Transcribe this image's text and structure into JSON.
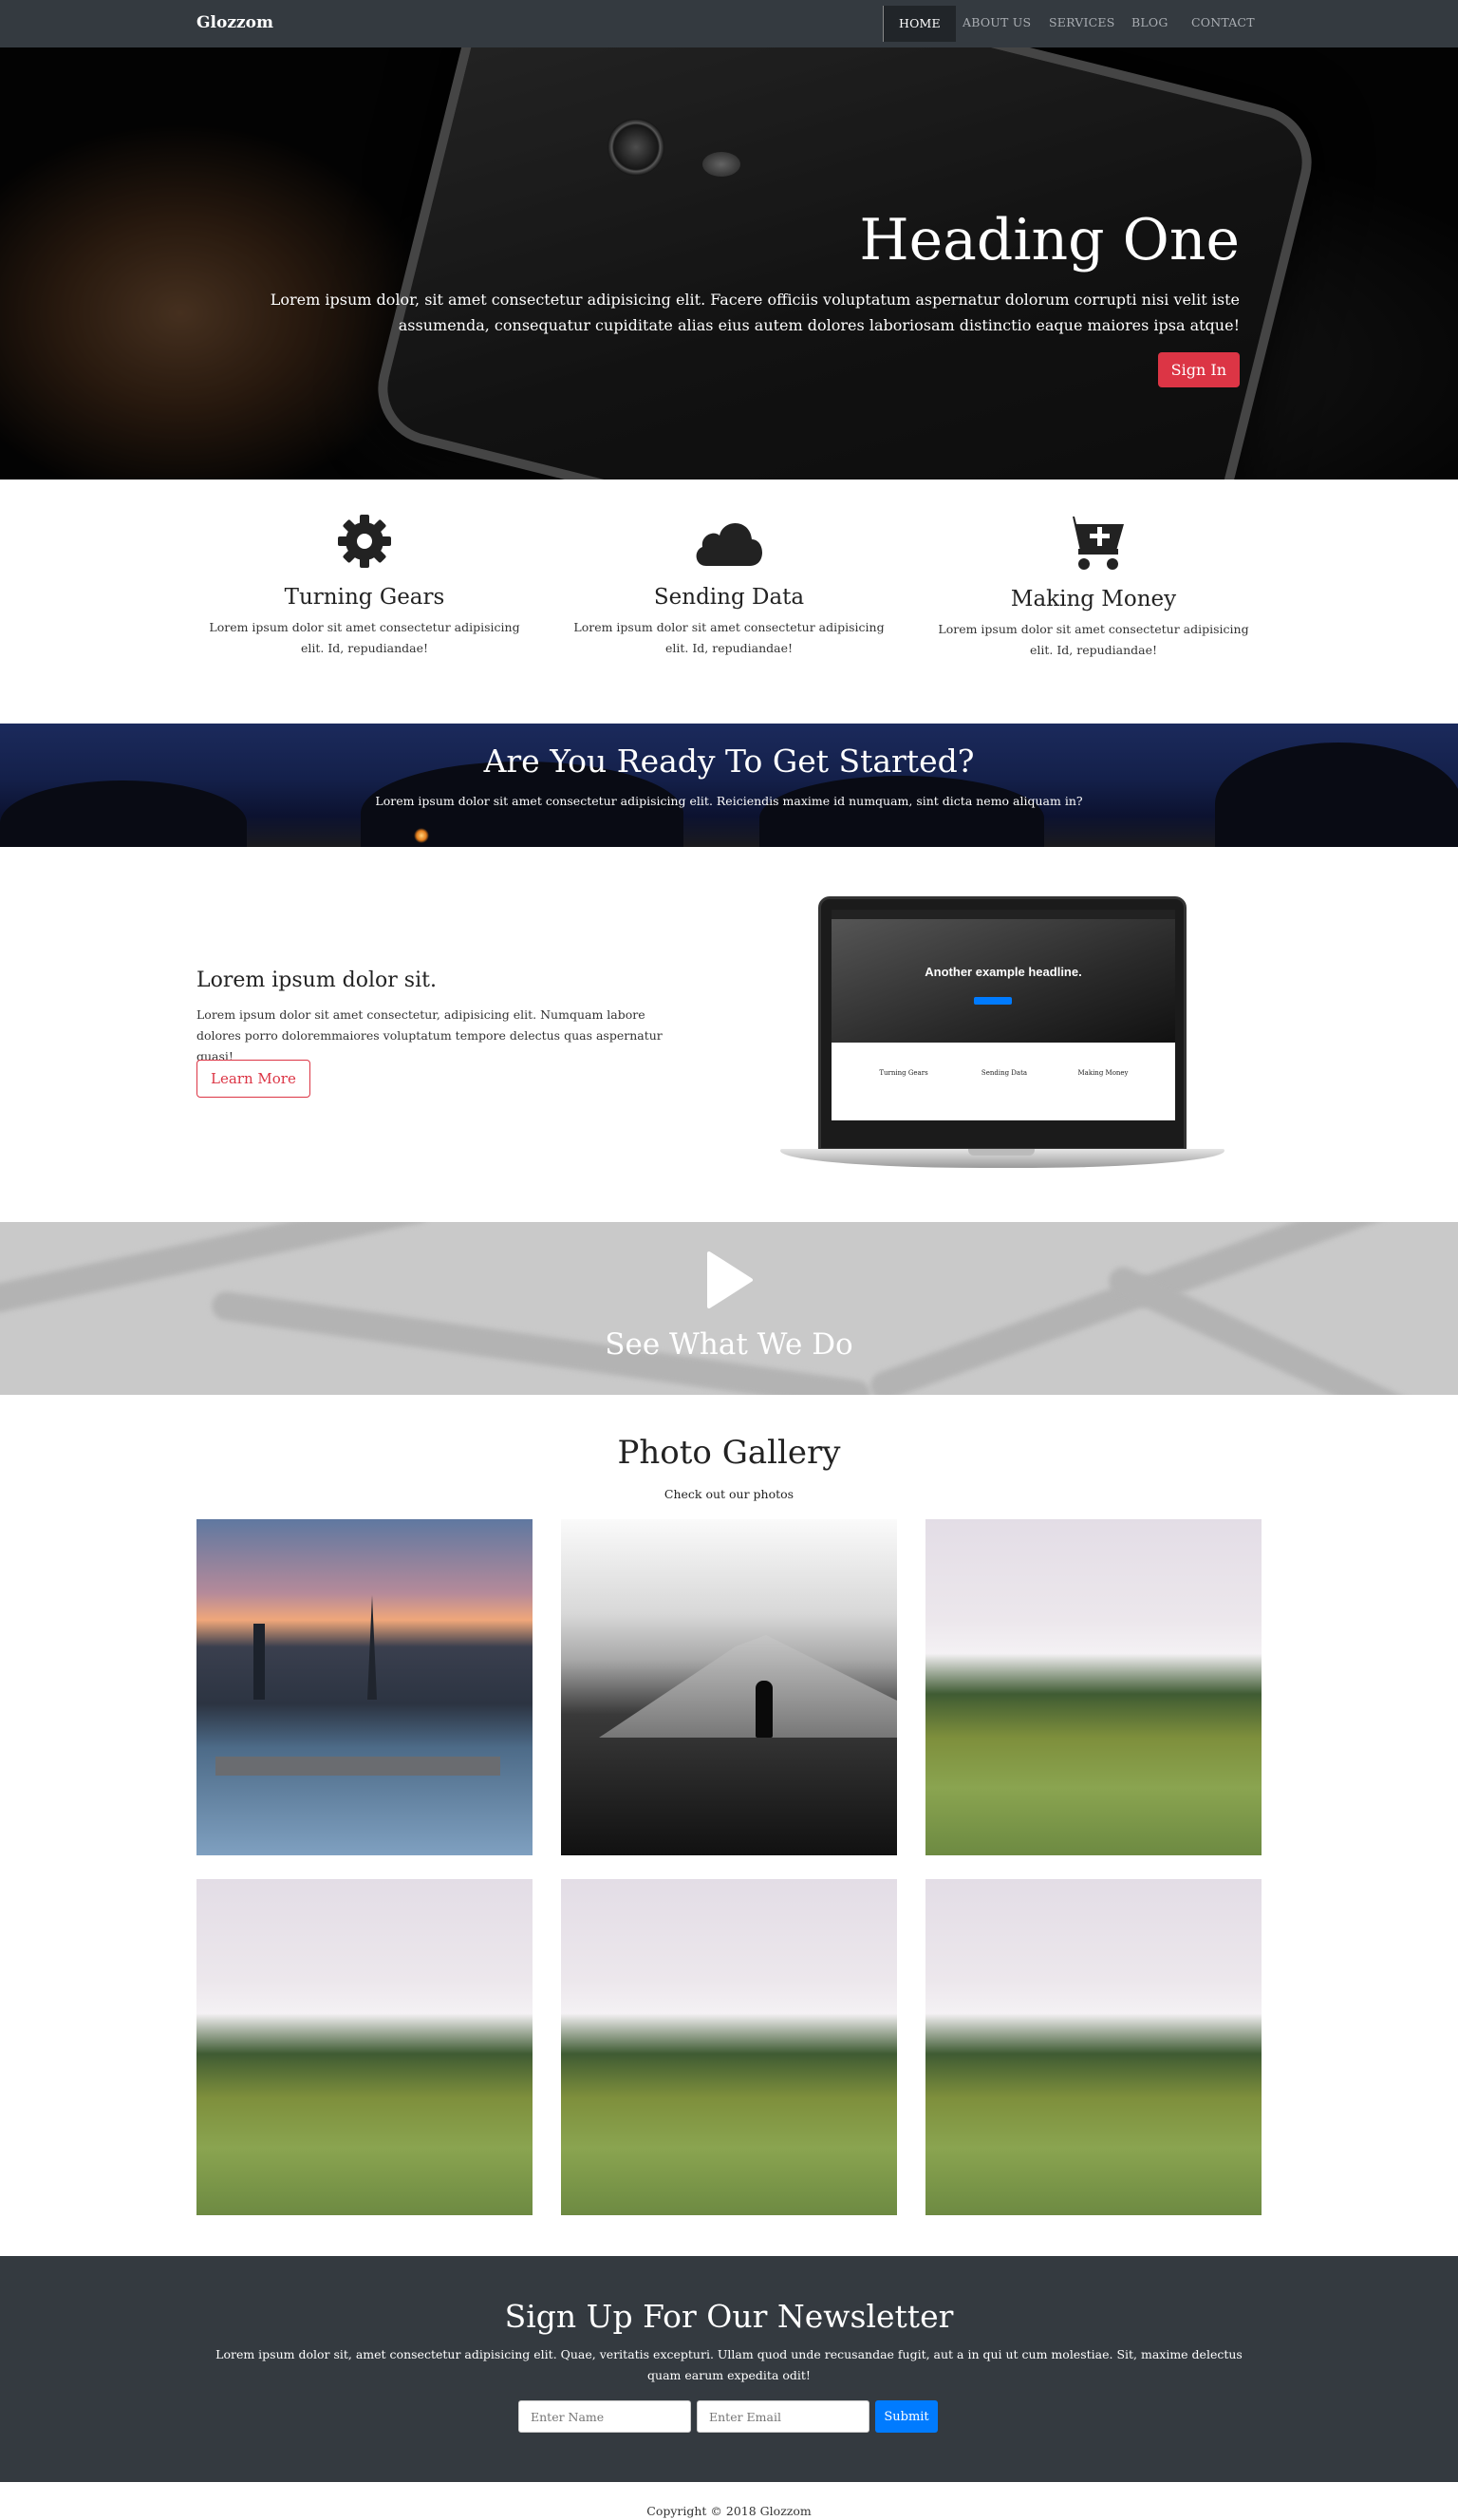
{
  "nav": {
    "brand": "Glozzom",
    "items": [
      "HOME",
      "ABOUT US",
      "SERVICES",
      "BLOG",
      "CONTACT"
    ],
    "active": "HOME"
  },
  "hero": {
    "title": "Heading One",
    "text": "Lorem ipsum dolor, sit amet consectetur adipisicing elit. Facere officiis voluptatum aspernatur dolorum corrupti nisi velit iste assumenda, consequatur cupiditate alias eius autem dolores laboriosam distinctio eaque maiores ipsa atque!",
    "button": "Sign In"
  },
  "features": [
    {
      "icon": "gear-icon",
      "title": "Turning Gears",
      "text": "Lorem ipsum dolor sit amet consectetur adipisicing elit. Id, repudiandae!"
    },
    {
      "icon": "cloud-icon",
      "title": "Sending Data",
      "text": "Lorem ipsum dolor sit amet consectetur adipisicing elit. Id, repudiandae!"
    },
    {
      "icon": "cart-plus-icon",
      "title": "Making Money",
      "text": "Lorem ipsum dolor sit amet consectetur adipisicing elit. Id, repudiandae!"
    }
  ],
  "ready": {
    "title": "Are You Ready To Get Started?",
    "text": "Lorem ipsum dolor sit amet consectetur adipisicing elit. Reiciendis maxime id numquam, sint dicta nemo aliquam in?"
  },
  "info": {
    "title": "Lorem ipsum dolor sit.",
    "text": "Lorem ipsum dolor sit amet consectetur, adipisicing elit. Numquam labore dolores porro doloremmaiores voluptatum tempore delectus quas aspernatur quasi!",
    "button": "Learn More"
  },
  "laptop": {
    "headline": "Another example headline.",
    "features": [
      "Turning Gears",
      "Sending Data",
      "Making Money"
    ]
  },
  "video": {
    "text": "See What We Do"
  },
  "gallery": {
    "title": "Photo Gallery",
    "subtitle": "Check out our photos"
  },
  "newsletter": {
    "title": "Sign Up For Our Newsletter",
    "text": "Lorem ipsum dolor sit, amet consectetur adipisicing elit. Quae, veritatis excepturi. Ullam quod unde recusandae fugit, aut a in qui ut cum molestiae. Sit, maxime delectus quam earum expedita odit!",
    "name_placeholder": "Enter Name",
    "email_placeholder": "Enter Email",
    "button": "Submit"
  },
  "footer": {
    "copyright": "Copyright © 2018 Glozzom"
  },
  "colors": {
    "nav": "#343a40",
    "accent": "#dc3545",
    "primary": "#007bff"
  }
}
